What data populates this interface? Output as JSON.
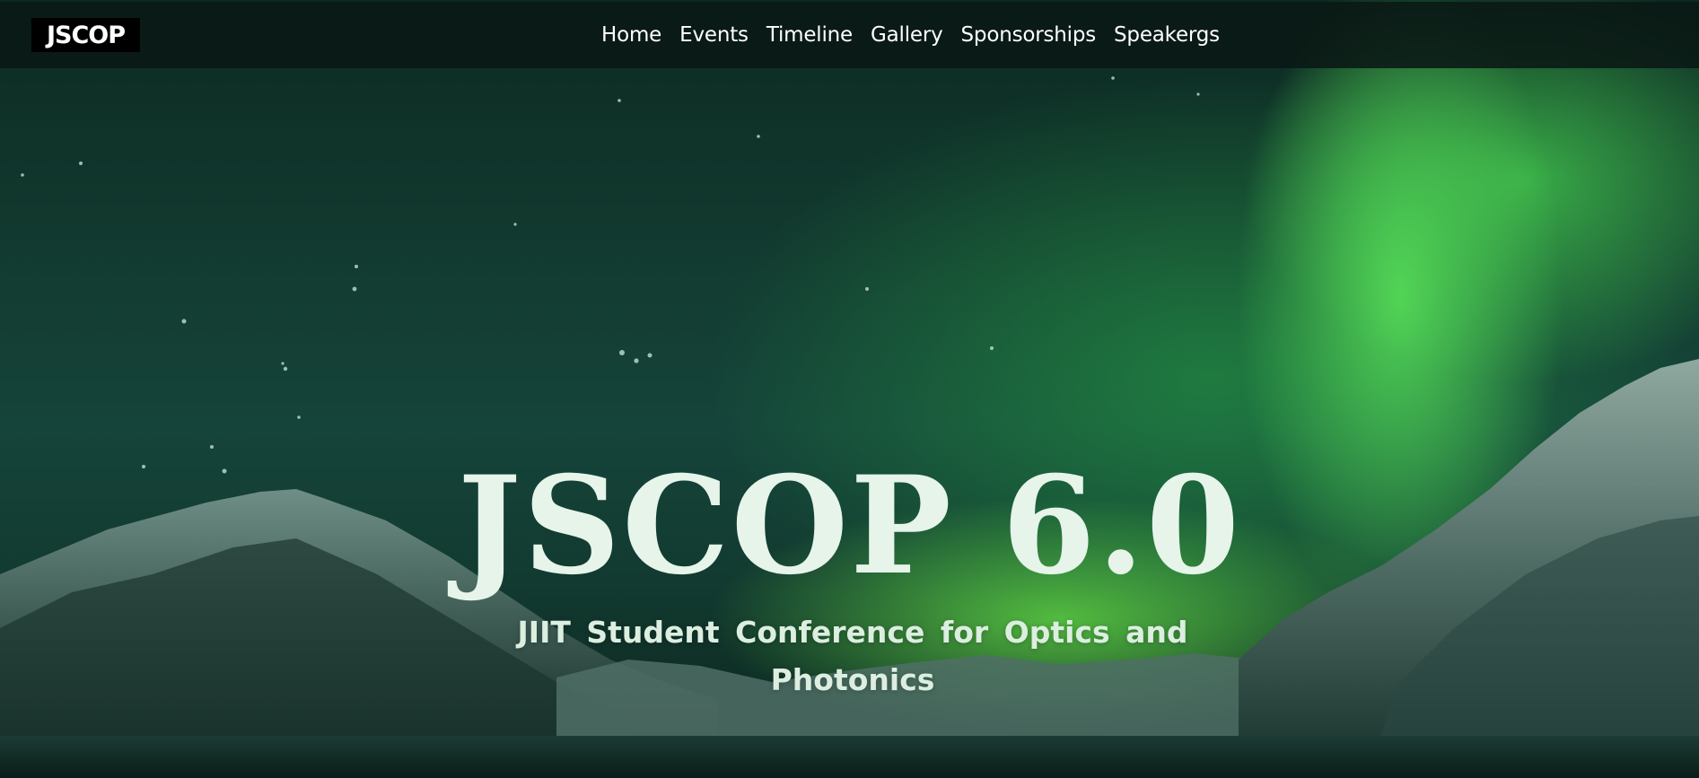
{
  "nav": {
    "logo_text": "JSCOP",
    "links": [
      "Home",
      "Events",
      "Timeline",
      "Gallery",
      "Sponsorships",
      "Speakergs"
    ]
  },
  "hero": {
    "title": "JSCOP 6.0",
    "subtitle": "JIIT Student Conference for Optics and Photonics"
  },
  "colors": {
    "nav_background": "#0a1814",
    "title_text": "#e6f4ea",
    "aurora_green": "#5ae65a"
  }
}
